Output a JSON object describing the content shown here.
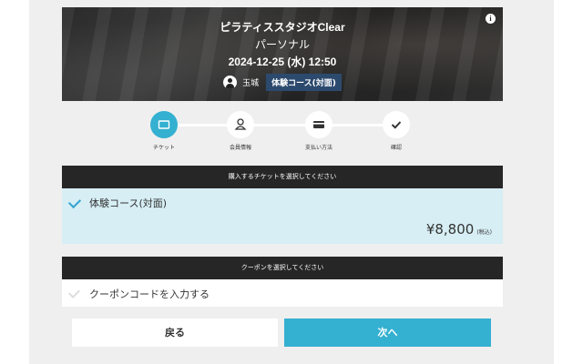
{
  "hero": {
    "studio_name": "ピラティススタジオClear",
    "menu_name": "パーソナル",
    "datetime": "2024-12-25 (水) 12:50",
    "staff_name": "玉城",
    "course_badge": "体験コース(対面)",
    "info_icon_glyph": "i"
  },
  "steps": [
    {
      "label": "チケット",
      "icon": "ticket-icon",
      "active": true
    },
    {
      "label": "会員情報",
      "icon": "user-icon",
      "active": false
    },
    {
      "label": "支払い方法",
      "icon": "credit-card-icon",
      "active": false
    },
    {
      "label": "確認",
      "icon": "check-icon",
      "active": false
    }
  ],
  "ticket_section": {
    "heading": "購入するチケットを選択してください",
    "ticket_name": "体験コース(対面)",
    "price": "¥8,800",
    "tax_note": "(税込)"
  },
  "coupon_section": {
    "heading": "クーポンを選択してください",
    "coupon_label": "クーポンコードを入力する"
  },
  "buttons": {
    "back": "戻る",
    "next": "次へ"
  },
  "colors": {
    "accent": "#34b0d0",
    "selected_bg": "#d6eef4",
    "header_bg": "#262626",
    "badge_bg": "#2c4a6e"
  }
}
